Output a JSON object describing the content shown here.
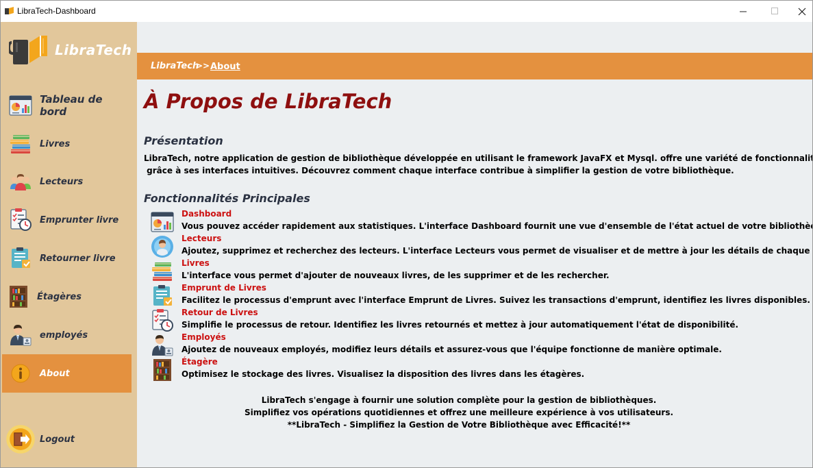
{
  "window": {
    "title": "LibraTech-Dashboard",
    "controls": {
      "minimize": "─",
      "maximize": "☐",
      "close": "✕"
    }
  },
  "sidebar": {
    "logo_text": "LibraTech",
    "items": [
      {
        "label": "Tableau de bord",
        "icon": "dashboard-icon"
      },
      {
        "label": "Livres",
        "icon": "books-icon"
      },
      {
        "label": "Lecteurs",
        "icon": "readers-icon"
      },
      {
        "label": "Emprunter livre",
        "icon": "borrow-icon"
      },
      {
        "label": "Retourner livre",
        "icon": "return-icon"
      },
      {
        "label": "Étagères",
        "icon": "shelf-icon"
      },
      {
        "label": "employés",
        "icon": "employee-icon"
      },
      {
        "label": "About",
        "icon": "info-icon",
        "active": true
      },
      {
        "label": "Logout",
        "icon": "logout-icon"
      }
    ]
  },
  "breadcrumb": {
    "app": "LibraTech",
    "separator": ">>",
    "current": "About"
  },
  "main": {
    "title": "À Propos de LibraTech",
    "presentation": {
      "heading": "Présentation",
      "line1": "LibraTech, notre application de gestion de bibliothèque développée en utilisant le framework JavaFX et Mysql. offre une variété de fonctionnalités conviviales",
      "line2": " grâce à ses interfaces intuitives. Découvrez comment chaque interface contribue à simplifier la gestion de votre bibliothèque."
    },
    "features_heading": "Fonctionnalités Principales",
    "features": [
      {
        "name": "Dashboard",
        "desc": "Vous pouvez accéder rapidement aux statistiques. L'interface Dashboard fournit une vue d'ensemble de l'état actuel de votre bibliothèque.",
        "icon": "dashboard-icon"
      },
      {
        "name": "Lecteurs",
        "desc": "Ajoutez, supprimez et recherchez des lecteurs. L'interface Lecteurs vous permet de visualiser et de mettre à jour les détails de chaque lecteur.",
        "icon": "reader-avatar-icon"
      },
      {
        "name": "Livres",
        "desc": "L'interface vous permet d'ajouter de nouveaux livres, de les supprimer et de les rechercher.",
        "icon": "books-icon"
      },
      {
        "name": "Emprunt de Livres",
        "desc": "Facilitez le processus d'emprunt avec l'interface Emprunt de Livres. Suivez les transactions d'emprunt, identifiez les livres disponibles.",
        "icon": "borrow-icon"
      },
      {
        "name": "Retour de Livres",
        "desc": "Simplifie le processus de retour. Identifiez les livres retournés et mettez à jour automatiquement l'état de disponibilité.",
        "icon": "return-icon"
      },
      {
        "name": "Employés",
        "desc": "Ajoutez de nouveaux employés, modifiez leurs détails et assurez-vous que l'équipe fonctionne de manière optimale.",
        "icon": "employee-icon"
      },
      {
        "name": "Étagère",
        "desc": "Optimisez le stockage des livres. Visualisez la disposition des livres dans les étagères.",
        "icon": "shelf-icon"
      }
    ],
    "closing": [
      "LibraTech s'engage à fournir une solution complète pour la gestion de bibliothèques.",
      "Simplifiez vos opérations quotidiennes et offrez une meilleure expérience à vos utilisateurs.",
      "**LibraTech - Simplifiez la Gestion de Votre Bibliothèque avec Efficacité!**"
    ]
  },
  "colors": {
    "sidebar": "#e2c79b",
    "accent": "#e4913f",
    "title": "#8e0f0f",
    "feature_name": "#cc1111",
    "content_bg": "#eceff1"
  }
}
